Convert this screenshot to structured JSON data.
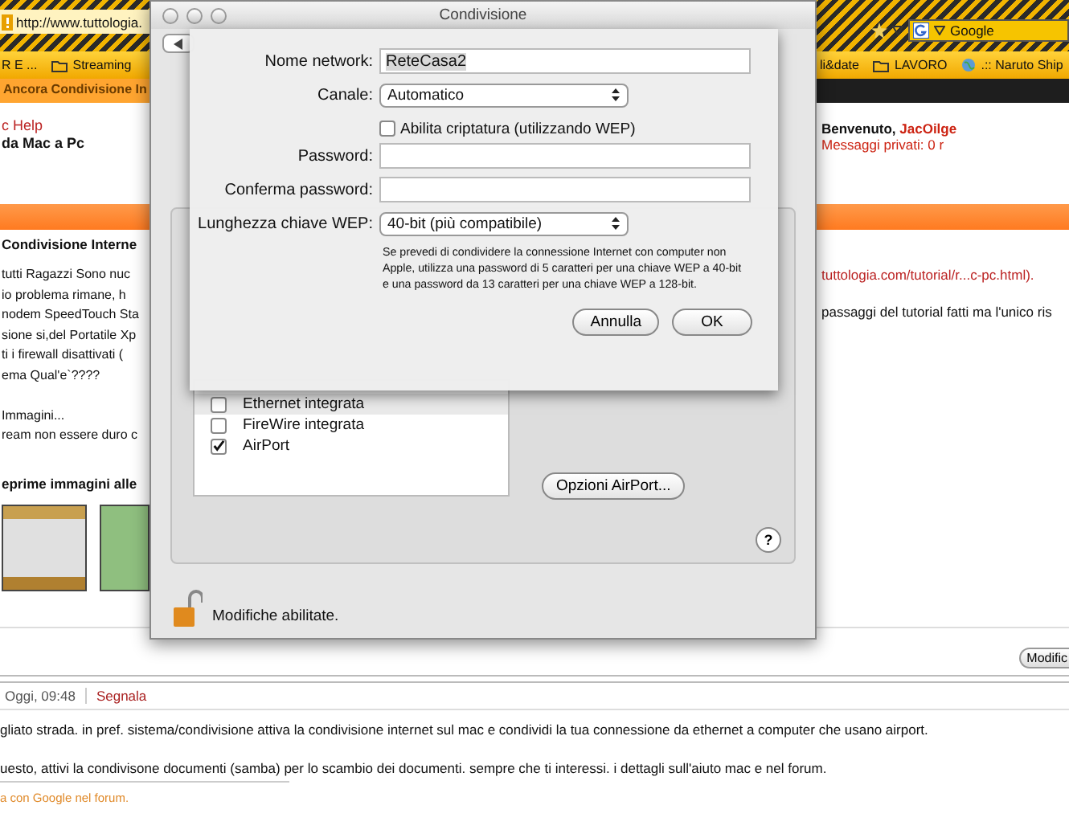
{
  "browser": {
    "address": "http://www.tuttologia.",
    "search": "Google",
    "bookmarks_left": [
      {
        "label": "R E ...",
        "kind": "plain"
      },
      {
        "label": "Streaming",
        "kind": "folder"
      }
    ],
    "bookmarks_right": [
      {
        "label": "li&date",
        "kind": "plain"
      },
      {
        "label": "LAVORO",
        "kind": "folder"
      },
      {
        "label": ".:: Naruto Ship",
        "kind": "site"
      }
    ],
    "tabs": [
      {
        "label": "Ancora Condivisione In",
        "selected": true
      }
    ]
  },
  "page": {
    "breadcrumb_link": "c Help",
    "breadcrumb_title": "da Mac a Pc",
    "welcome": "Benvenuto,",
    "username": "JacOilge",
    "messages": "Messaggi privati: 0 r",
    "post_title": "Condivisione Interne",
    "post_paragraphs": [
      [
        "tutti Ragazzi Sono nuc",
        "io problema rimane, h",
        "nodem SpeedTouch Sta",
        "sione si,del Portatile Xp",
        "ti i firewall disattivati (",
        "ema Qual'e`????"
      ],
      [
        "Immagini...",
        "ream non essere duro c"
      ]
    ],
    "link_text": "tuttologia.com/tutorial/r...c-pc.html).",
    "right_line": "passaggi del tutorial fatti ma l'unico ris",
    "images_heading": "eprime immagini alle",
    "edit_button": "Modific",
    "reply_time": "Oggi, 09:48",
    "reply_report": "Segnala",
    "reply_lines": [
      "gliato strada. in pref. sistema/condivisione attiva la condivisione internet sul mac e condividi la tua connessione da ethernet a computer che usano airport.",
      "uesto, attivi la condivisone documenti (samba) per lo scambio dei documenti. sempre che ti interessi. i dettagli sull'aiuto mac e nel forum."
    ],
    "footer_link": "a con Google nel forum."
  },
  "prefs_window": {
    "title": "Condivisione",
    "interfaces": [
      {
        "label": "Ethernet integrata",
        "checked": false,
        "selected": true
      },
      {
        "label": "FireWire integrata",
        "checked": false,
        "selected": false
      },
      {
        "label": "AirPort",
        "checked": true,
        "selected": false
      }
    ],
    "airport_options": "Opzioni AirPort...",
    "help": "?",
    "lock_label": "Modifiche abilitate."
  },
  "sheet": {
    "fields": [
      {
        "label": "Nome network:",
        "kind": "text",
        "value": "ReteCasa2"
      },
      {
        "label": "Canale:",
        "kind": "popup",
        "value": "Automatico"
      },
      {
        "label": "Abilita criptatura (utilizzando WEP)",
        "kind": "checkbox",
        "checked": false
      },
      {
        "label": "Password:",
        "kind": "password"
      },
      {
        "label": "Conferma password:",
        "kind": "password"
      },
      {
        "label": "Lunghezza chiave WEP:",
        "kind": "popup",
        "value": "40-bit (più compatibile)"
      }
    ],
    "note": "Se prevedi di condividere la connessione Internet con computer non Apple, utilizza una password di 5 caratteri per una chiave WEP a 40-bit e una password da 13 caratteri per una chiave WEP a 128-bit.",
    "buttons": [
      "Annulla",
      "OK"
    ]
  }
}
